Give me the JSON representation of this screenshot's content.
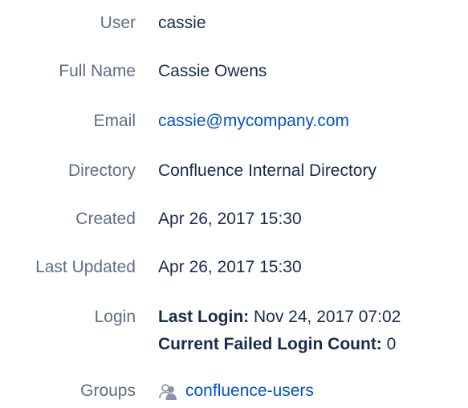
{
  "user": {
    "label": "User",
    "value": "cassie"
  },
  "full_name": {
    "label": "Full Name",
    "value": "Cassie Owens"
  },
  "email": {
    "label": "Email",
    "value": "cassie@mycompany.com"
  },
  "directory": {
    "label": "Directory",
    "value": "Confluence Internal Directory"
  },
  "created": {
    "label": "Created",
    "value": "Apr 26, 2017 15:30"
  },
  "last_updated": {
    "label": "Last Updated",
    "value": "Apr 26, 2017 15:30"
  },
  "login": {
    "label": "Login",
    "last_login_label": "Last Login:",
    "last_login_value": "Nov 24, 2017 07:02",
    "failed_count_label": "Current Failed Login Count:",
    "failed_count_value": "0"
  },
  "groups": {
    "label": "Groups",
    "items": [
      {
        "name": "confluence-users",
        "icon": "group-icon"
      }
    ]
  },
  "colors": {
    "label_text": "#5e6c84",
    "value_text": "#172b4d",
    "link": "#0052cc",
    "icon_gray": "#8993a4"
  }
}
